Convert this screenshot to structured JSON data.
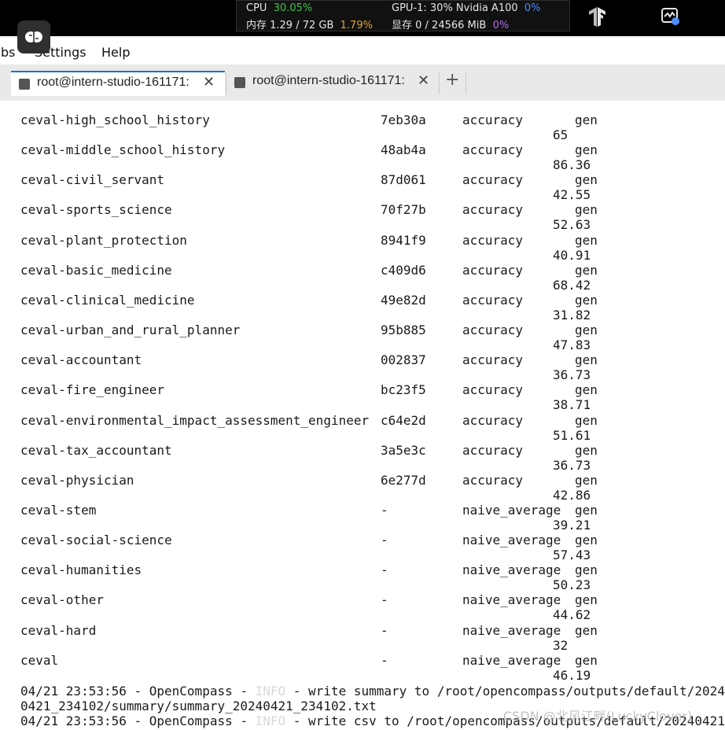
{
  "system_monitor": {
    "cpu_label": "CPU",
    "cpu_value": "30.05%",
    "mem_label": "内存 1.29 / 72 GB",
    "mem_value": "1.79%",
    "gpu_label": "GPU-1: 30% Nvidia A100",
    "gpu_value": "0%",
    "vram_label": "显存 0 / 24566 MiB",
    "vram_value": "0%"
  },
  "menu": {
    "items": [
      "bs",
      "Settings",
      "Help"
    ]
  },
  "tabs": [
    {
      "label": "root@intern-studio-161171:",
      "active": true
    },
    {
      "label": "root@intern-studio-161171:",
      "active": false
    }
  ],
  "terminal": {
    "rows": [
      {
        "dataset": "ceval-high_school_history",
        "version": "7eb30a",
        "metric": "accuracy",
        "mode": "gen",
        "score": "65"
      },
      {
        "dataset": "ceval-middle_school_history",
        "version": "48ab4a",
        "metric": "accuracy",
        "mode": "gen",
        "score": "86.36"
      },
      {
        "dataset": "ceval-civil_servant",
        "version": "87d061",
        "metric": "accuracy",
        "mode": "gen",
        "score": "42.55"
      },
      {
        "dataset": "ceval-sports_science",
        "version": "70f27b",
        "metric": "accuracy",
        "mode": "gen",
        "score": "52.63"
      },
      {
        "dataset": "ceval-plant_protection",
        "version": "8941f9",
        "metric": "accuracy",
        "mode": "gen",
        "score": "40.91"
      },
      {
        "dataset": "ceval-basic_medicine",
        "version": "c409d6",
        "metric": "accuracy",
        "mode": "gen",
        "score": "68.42"
      },
      {
        "dataset": "ceval-clinical_medicine",
        "version": "49e82d",
        "metric": "accuracy",
        "mode": "gen",
        "score": "31.82"
      },
      {
        "dataset": "ceval-urban_and_rural_planner",
        "version": "95b885",
        "metric": "accuracy",
        "mode": "gen",
        "score": "47.83"
      },
      {
        "dataset": "ceval-accountant",
        "version": "002837",
        "metric": "accuracy",
        "mode": "gen",
        "score": "36.73"
      },
      {
        "dataset": "ceval-fire_engineer",
        "version": "bc23f5",
        "metric": "accuracy",
        "mode": "gen",
        "score": "38.71"
      },
      {
        "dataset": "ceval-environmental_impact_assessment_engineer",
        "version": "c64e2d",
        "metric": "accuracy",
        "mode": "gen",
        "score": "51.61"
      },
      {
        "dataset": "ceval-tax_accountant",
        "version": "3a5e3c",
        "metric": "accuracy",
        "mode": "gen",
        "score": "36.73"
      },
      {
        "dataset": "ceval-physician",
        "version": "6e277d",
        "metric": "accuracy",
        "mode": "gen",
        "score": "42.86"
      },
      {
        "dataset": "ceval-stem",
        "version": "-",
        "metric": "naive_average",
        "mode": "gen",
        "score": "39.21"
      },
      {
        "dataset": "ceval-social-science",
        "version": "-",
        "metric": "naive_average",
        "mode": "gen",
        "score": "57.43"
      },
      {
        "dataset": "ceval-humanities",
        "version": "-",
        "metric": "naive_average",
        "mode": "gen",
        "score": "50.23"
      },
      {
        "dataset": "ceval-other",
        "version": "-",
        "metric": "naive_average",
        "mode": "gen",
        "score": "44.62"
      },
      {
        "dataset": "ceval-hard",
        "version": "-",
        "metric": "naive_average",
        "mode": "gen",
        "score": "32"
      },
      {
        "dataset": "ceval",
        "version": "-",
        "metric": "naive_average",
        "mode": "gen",
        "score": "46.19"
      }
    ],
    "log1_prefix": "04/21 23:53:56 - OpenCompass - ",
    "log1_level": "INFO",
    "log1_msg": " - write summary to /root/opencompass/outputs/default/2024",
    "log1_cont": "0421_234102/summary/summary_20240421_234102.txt",
    "log2_prefix": "04/21 23:53:56 - OpenCompass - ",
    "log2_level": "INFO",
    "log2_msg": " - write csv to /root/opencompass/outputs/default/20240421"
  },
  "watermark": "CSDN @北风江畔(LuckyClover)"
}
